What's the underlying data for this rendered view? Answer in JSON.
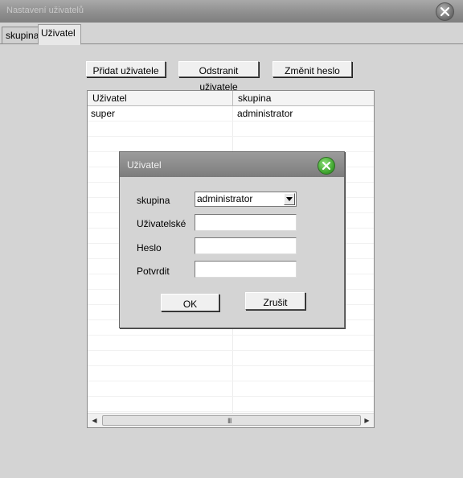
{
  "window": {
    "title": "Nastavení uživatelů",
    "close_icon": "close-icon"
  },
  "tabs": [
    {
      "label": "skupina",
      "active": false
    },
    {
      "label": "Uživatel",
      "active": true
    }
  ],
  "toolbar": {
    "add_user": "Přidat uživatele",
    "remove_user": "Odstranit uživatele",
    "change_password": "Změnit heslo"
  },
  "table": {
    "columns": [
      "Uživatel",
      "skupina"
    ],
    "rows": [
      {
        "user": "super",
        "group": "administrator"
      }
    ]
  },
  "dialog": {
    "title": "Uživatel",
    "close_icon": "green-close-icon",
    "group_label": "skupina",
    "group_value": "administrator",
    "username_label": "Uživatelské",
    "username_value": "",
    "password_label": "Heslo",
    "password_value": "",
    "confirm_label": "Potvrdit",
    "confirm_value": "",
    "ok_label": "OK",
    "cancel_label": "Zrušit"
  },
  "scrollbar": {
    "grip_label": "III"
  }
}
